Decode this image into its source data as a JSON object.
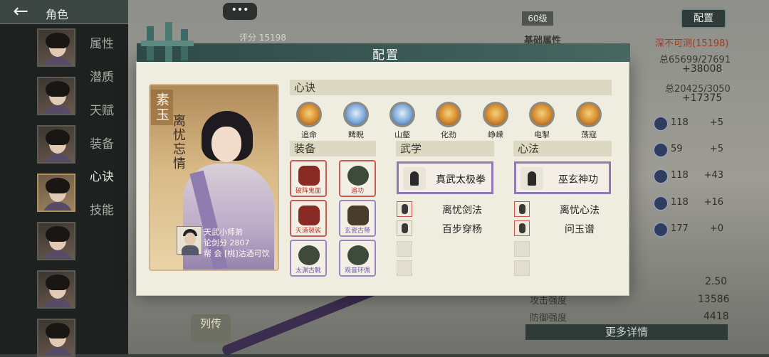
{
  "sidebar": {
    "back_icon": "back-arrow-icon",
    "title": "角色",
    "tabs": [
      "属性",
      "潜质",
      "天赋",
      "装备",
      "心诀",
      "技能"
    ],
    "active_tab_index": 4
  },
  "top": {
    "chat_label": "•••",
    "score_label": "评分",
    "score_value": "15198",
    "level": "60级",
    "config_button": "配置"
  },
  "right_panel": {
    "heading": "基础属性",
    "rank_text": "深不可测(15198)",
    "total1": "总65699/27691",
    "delta1": "+38008",
    "total2": "总20425/3050",
    "delta2": "+17375",
    "attrs": [
      {
        "value": "118",
        "delta": "+5"
      },
      {
        "value": "59",
        "delta": "+5"
      },
      {
        "value": "118",
        "delta": "+43"
      },
      {
        "value": "118",
        "delta": "+16"
      },
      {
        "value": "177",
        "delta": "+0"
      }
    ],
    "ratio_value": "2.50",
    "attack_label": "攻击强度",
    "attack_value": "13586",
    "defense_label": "防御强度",
    "defense_value": "4418",
    "more_button": "更多详情"
  },
  "bottom_left_button": "列传",
  "modal": {
    "title": "配置",
    "character": {
      "name": "素玉",
      "title": "离忧忘情",
      "owner_line1": "天武小师弟",
      "owner_line2": "论剑分 2807",
      "owner_line3": "帮  会 [桃]沽酒可饮"
    },
    "xinjue": {
      "label": "心诀",
      "skills": [
        {
          "name": "追命",
          "style": "gold"
        },
        {
          "name": "睥睨",
          "style": "blue"
        },
        {
          "name": "山壑",
          "style": "blue"
        },
        {
          "name": "化劲",
          "style": "gold"
        },
        {
          "name": "峥嵘",
          "style": "gold"
        },
        {
          "name": "电掣",
          "style": "gold"
        },
        {
          "name": "荡寇",
          "style": "gold"
        }
      ]
    },
    "equipment": {
      "label": "装备",
      "items": [
        {
          "name": "破阵鬼面",
          "quality": "red"
        },
        {
          "name": "追功",
          "quality": "red"
        },
        {
          "name": "天道袈裟",
          "quality": "red"
        },
        {
          "name": "玄瓷古带",
          "quality": "purple"
        },
        {
          "name": "太渊古靴",
          "quality": "purple"
        },
        {
          "name": "观音环佩",
          "quality": "purple"
        }
      ]
    },
    "martial": {
      "label": "武学",
      "main": "真武太极拳",
      "subs": [
        "离忧剑法",
        "百步穿杨"
      ]
    },
    "mind": {
      "label": "心法",
      "main": "巫玄神功",
      "subs": [
        "离忧心法",
        "问玉谱"
      ]
    }
  }
}
